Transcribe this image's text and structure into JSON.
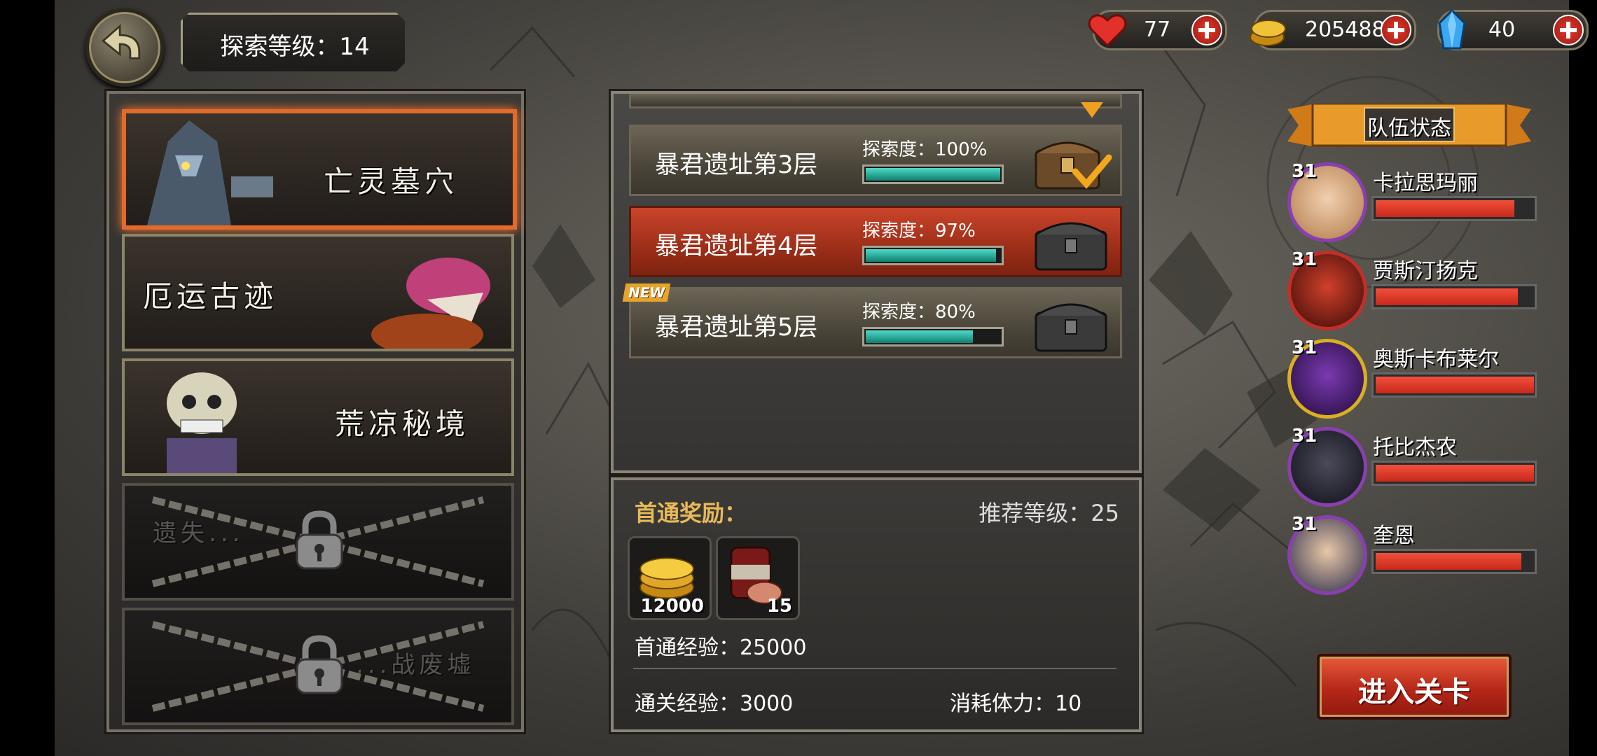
{
  "header": {
    "explore_level_label": "探索等级：14"
  },
  "resources": [
    {
      "icon": "heart-icon",
      "value": "77",
      "color": "#e2302a"
    },
    {
      "icon": "gold-coin-icon",
      "value": "205488",
      "color": "#e6b12a"
    },
    {
      "icon": "crystal-icon",
      "value": "40",
      "color": "#3aa7f0"
    }
  ],
  "zones": [
    {
      "name": "亡灵墓穴",
      "active": true,
      "locked": false
    },
    {
      "name": "厄运古迹",
      "active": false,
      "locked": false
    },
    {
      "name": "荒凉秘境",
      "active": false,
      "locked": false
    },
    {
      "name": "遗失...",
      "active": false,
      "locked": true
    },
    {
      "name": "...战废墟",
      "active": false,
      "locked": true
    }
  ],
  "floors": [
    {
      "name": "暴君遗址第3层",
      "explore_label": "探索度：100%",
      "progress": 1.0,
      "completed": true,
      "selected": false,
      "new": false
    },
    {
      "name": "暴君遗址第4层",
      "explore_label": "探索度：97%",
      "progress": 0.97,
      "completed": false,
      "selected": true,
      "new": false
    },
    {
      "name": "暴君遗址第5层",
      "explore_label": "探索度：80%",
      "progress": 0.8,
      "completed": false,
      "selected": false,
      "new": true
    }
  ],
  "new_tag": "NEW",
  "reward": {
    "title": "首通奖励：",
    "recommended_level": "推荐等级：25",
    "items": [
      {
        "icon": "gold-coin-icon",
        "count": "12000"
      },
      {
        "icon": "meat-can-icon",
        "count": "15"
      }
    ],
    "first_clear_exp": "首通经验：25000",
    "clear_exp": "通关经验：3000",
    "stamina_cost": "消耗体力：10"
  },
  "team": {
    "title": "队伍状态",
    "members": [
      {
        "level": "31",
        "name": "卡拉思玛丽",
        "hp": 0.88
      },
      {
        "level": "31",
        "name": "贾斯汀扬克",
        "hp": 0.9
      },
      {
        "level": "31",
        "name": "奥斯卡布莱尔",
        "hp": 1.0
      },
      {
        "level": "31",
        "name": "托比杰农",
        "hp": 1.0
      },
      {
        "level": "31",
        "name": "奎恩",
        "hp": 0.92
      }
    ]
  },
  "enter_button": "进入关卡"
}
